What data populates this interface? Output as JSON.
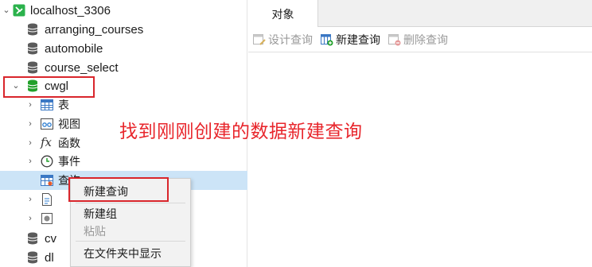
{
  "nav": {
    "connection": {
      "label": "localhost_3306"
    },
    "databases_above": [
      {
        "label": "arranging_courses"
      },
      {
        "label": "automobile"
      },
      {
        "label": "course_select"
      }
    ],
    "open_db": {
      "label": "cwgl"
    },
    "children": [
      {
        "label": "表"
      },
      {
        "label": "视图"
      },
      {
        "label": "函数"
      },
      {
        "label": "事件"
      },
      {
        "label": "查询"
      }
    ],
    "databases_below": [
      {
        "label": "cv"
      },
      {
        "label": "dl"
      }
    ]
  },
  "tabs": {
    "objects": "对象"
  },
  "toolbar": {
    "design_query": "设计查询",
    "new_query": "新建查询",
    "delete_query": "删除查询"
  },
  "annotation": "找到刚刚创建的数据新建查询",
  "context_menu": {
    "items": [
      "新建查询",
      "新建组",
      "粘贴",
      "在文件夹中显示"
    ]
  },
  "colors": {
    "highlight_box": "#d9262c",
    "annotation_text": "#e8262c",
    "db_icon_open": "#22a02a",
    "db_icon": "#5b5b5b",
    "selection": "#cce4f7"
  }
}
